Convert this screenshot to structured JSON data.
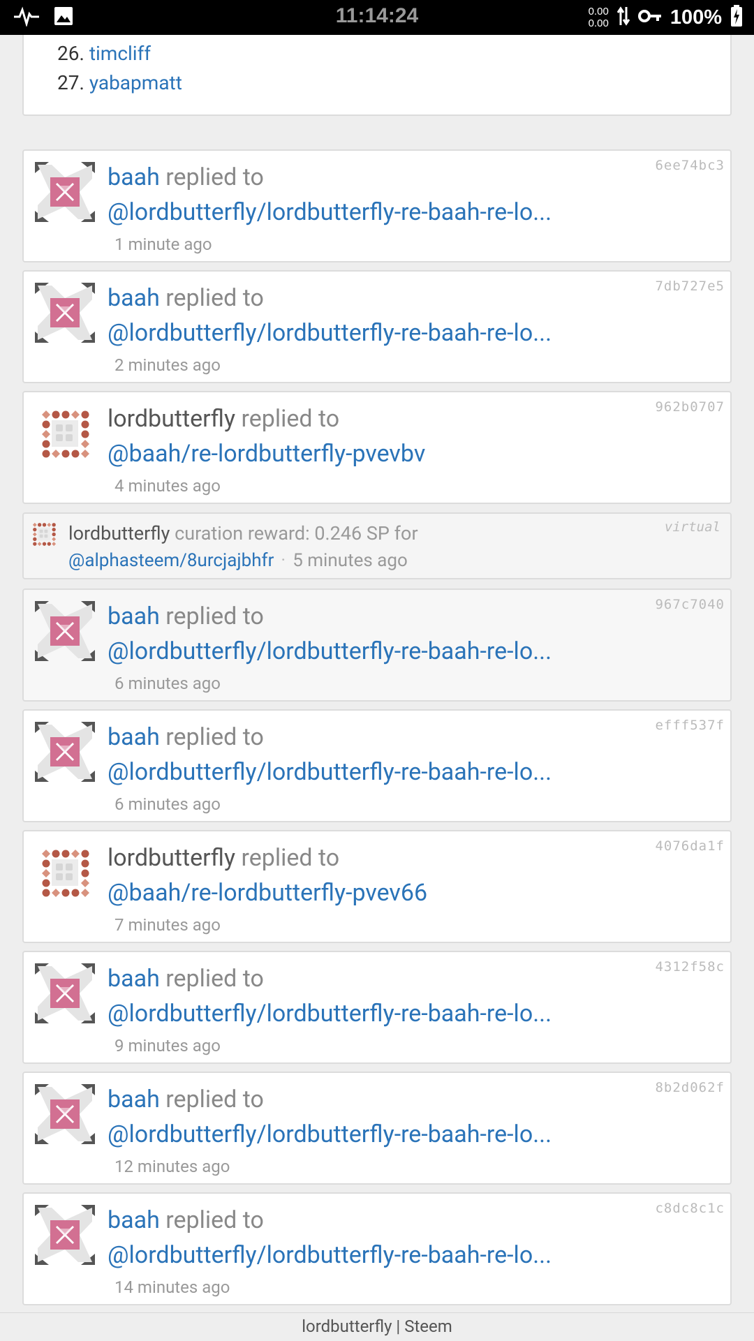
{
  "status_bar": {
    "time": "11:14:24",
    "net_up": "0.00",
    "net_down": "0.00",
    "battery": "100%",
    "icons": [
      "activity-icon",
      "image-icon",
      "data-arrows-icon",
      "vpn-key-icon",
      "battery-charging-icon"
    ]
  },
  "ranking": {
    "items": [
      {
        "num": "26.",
        "name": "timcliff"
      },
      {
        "num": "27.",
        "name": "yabapmatt"
      }
    ]
  },
  "activity": [
    {
      "user": "baah",
      "action": "replied to",
      "target": "@lordbutterfly/lordbutterfly-re-baah-re-lo...",
      "time": "1 minute ago",
      "hash": "6ee74bc3",
      "avatar": "baah"
    },
    {
      "user": "baah",
      "action": "replied to",
      "target": "@lordbutterfly/lordbutterfly-re-baah-re-lo...",
      "time": "2 minutes ago",
      "hash": "7db727e5",
      "avatar": "baah"
    },
    {
      "user": "lordbutterfly",
      "action": "replied to",
      "target": "@baah/re-lordbutterfly-pvevbv",
      "time": "4 minutes ago",
      "hash": "962b0707",
      "avatar": "lordbutterfly"
    },
    {
      "user": "baah",
      "action": "replied to",
      "target": "@lordbutterfly/lordbutterfly-re-baah-re-lo...",
      "time": "6 minutes ago",
      "hash": "967c7040",
      "avatar": "baah"
    },
    {
      "user": "baah",
      "action": "replied to",
      "target": "@lordbutterfly/lordbutterfly-re-baah-re-lo...",
      "time": "6 minutes ago",
      "hash": "efff537f",
      "avatar": "baah"
    },
    {
      "user": "lordbutterfly",
      "action": "replied to",
      "target": "@baah/re-lordbutterfly-pvev66",
      "time": "7 minutes ago",
      "hash": "4076da1f",
      "avatar": "lordbutterfly"
    },
    {
      "user": "baah",
      "action": "replied to",
      "target": "@lordbutterfly/lordbutterfly-re-baah-re-lo...",
      "time": "9 minutes ago",
      "hash": "4312f58c",
      "avatar": "baah"
    },
    {
      "user": "baah",
      "action": "replied to",
      "target": "@lordbutterfly/lordbutterfly-re-baah-re-lo...",
      "time": "12 minutes ago",
      "hash": "8b2d062f",
      "avatar": "baah"
    },
    {
      "user": "baah",
      "action": "replied to",
      "target": "@lordbutterfly/lordbutterfly-re-baah-re-lo...",
      "time": "14 minutes ago",
      "hash": "c8dc8c1c",
      "avatar": "baah"
    }
  ],
  "virtual_op": {
    "user": "lordbutterfly",
    "text": "curation reward: 0.246 SP for",
    "link": "@alphasteem/8urcjajbhfr",
    "separator": "·",
    "time": "5 minutes ago",
    "hash": "virtual"
  },
  "footer": {
    "title": "lordbutterfly | Steem"
  },
  "colors": {
    "link": "#2a73b8",
    "muted": "#888888",
    "background": "#eeeeee"
  }
}
